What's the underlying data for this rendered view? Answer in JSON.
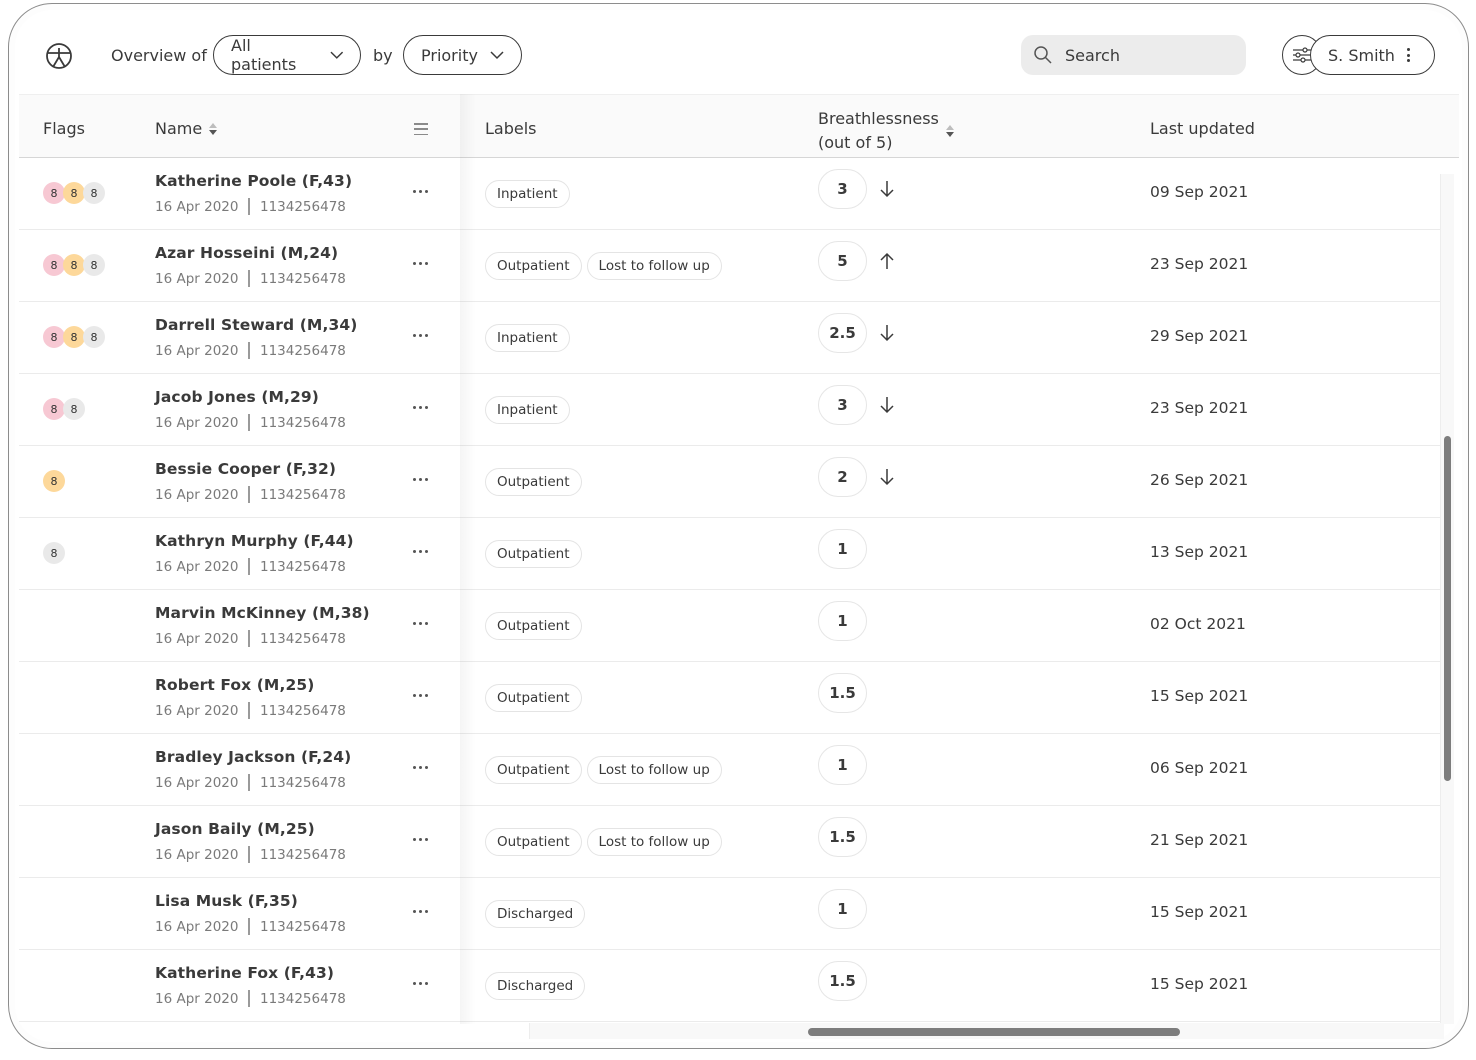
{
  "topbar": {
    "logo_icon": "vitruvian-figure-icon",
    "overview_prefix": "Overview of",
    "patients_select": "All patients",
    "by_text": "by",
    "sort_select": "Priority",
    "search_placeholder": "Search",
    "search_value": "",
    "filter_icon": "sliders-icon",
    "user_label": "S. Smith",
    "user_menu_icon": "kebab-icon"
  },
  "table": {
    "headers": {
      "flags": "Flags",
      "name": "Name",
      "labels": "Labels",
      "breathlessness_line1": "Breathlessness",
      "breathlessness_line2": "(out of 5)",
      "last_updated": "Last updated"
    },
    "colors": {
      "flag_red": "#f7c8d3",
      "flag_amber": "#fdd89a",
      "flag_grey": "#e9e9e9"
    },
    "rows": [
      {
        "flags": [
          {
            "color": "red",
            "value": "8"
          },
          {
            "color": "amber",
            "value": "8"
          },
          {
            "color": "grey",
            "value": "8"
          }
        ],
        "name": "Katherine Poole (F,43)",
        "date": "16 Apr 2020",
        "id": "1134256478",
        "labels": [
          "Inpatient"
        ],
        "score": "3",
        "trend": "down",
        "updated": "09 Sep 2021"
      },
      {
        "flags": [
          {
            "color": "red",
            "value": "8"
          },
          {
            "color": "amber",
            "value": "8"
          },
          {
            "color": "grey",
            "value": "8"
          }
        ],
        "name": "Azar Hosseini (M,24)",
        "date": "16 Apr 2020",
        "id": "1134256478",
        "labels": [
          "Outpatient",
          "Lost to follow up"
        ],
        "score": "5",
        "trend": "up",
        "updated": "23 Sep 2021"
      },
      {
        "flags": [
          {
            "color": "red",
            "value": "8"
          },
          {
            "color": "amber",
            "value": "8"
          },
          {
            "color": "grey",
            "value": "8"
          }
        ],
        "name": "Darrell Steward (M,34)",
        "date": "16 Apr 2020",
        "id": "1134256478",
        "labels": [
          "Inpatient"
        ],
        "score": "2.5",
        "trend": "down",
        "updated": "29 Sep 2021"
      },
      {
        "flags": [
          {
            "color": "red",
            "value": "8"
          },
          {
            "color": "grey",
            "value": "8"
          }
        ],
        "name": "Jacob Jones (M,29)",
        "date": "16 Apr 2020",
        "id": "1134256478",
        "labels": [
          "Inpatient"
        ],
        "score": "3",
        "trend": "down",
        "updated": "23 Sep 2021"
      },
      {
        "flags": [
          {
            "color": "amber",
            "value": "8"
          }
        ],
        "name": "Bessie Cooper (F,32)",
        "date": "16 Apr 2020",
        "id": "1134256478",
        "labels": [
          "Outpatient"
        ],
        "score": "2",
        "trend": "down",
        "updated": "26 Sep 2021"
      },
      {
        "flags": [
          {
            "color": "grey",
            "value": "8"
          }
        ],
        "name": "Kathryn Murphy (F,44)",
        "date": "16 Apr 2020",
        "id": "1134256478",
        "labels": [
          "Outpatient"
        ],
        "score": "1",
        "trend": "",
        "updated": "13 Sep 2021"
      },
      {
        "flags": [],
        "name": "Marvin McKinney (M,38)",
        "date": "16 Apr 2020",
        "id": "1134256478",
        "labels": [
          "Outpatient"
        ],
        "score": "1",
        "trend": "",
        "updated": "02 Oct 2021"
      },
      {
        "flags": [],
        "name": "Robert Fox (M,25)",
        "date": "16 Apr 2020",
        "id": "1134256478",
        "labels": [
          "Outpatient"
        ],
        "score": "1.5",
        "trend": "",
        "updated": "15 Sep 2021"
      },
      {
        "flags": [],
        "name": "Bradley Jackson (F,24)",
        "date": "16 Apr 2020",
        "id": "1134256478",
        "labels": [
          "Outpatient",
          "Lost to follow up"
        ],
        "score": "1",
        "trend": "",
        "updated": "06 Sep 2021"
      },
      {
        "flags": [],
        "name": "Jason Baily (M,25)",
        "date": "16 Apr 2020",
        "id": "1134256478",
        "labels": [
          "Outpatient",
          "Lost to follow up"
        ],
        "score": "1.5",
        "trend": "",
        "updated": "21 Sep 2021"
      },
      {
        "flags": [],
        "name": "Lisa Musk (F,35)",
        "date": "16 Apr 2020",
        "id": "1134256478",
        "labels": [
          "Discharged"
        ],
        "score": "1",
        "trend": "",
        "updated": "15 Sep 2021"
      },
      {
        "flags": [],
        "name": "Katherine Fox (F,43)",
        "date": "16 Apr 2020",
        "id": "1134256478",
        "labels": [
          "Discharged"
        ],
        "score": "1.5",
        "trend": "",
        "updated": "15 Sep 2021"
      }
    ]
  }
}
